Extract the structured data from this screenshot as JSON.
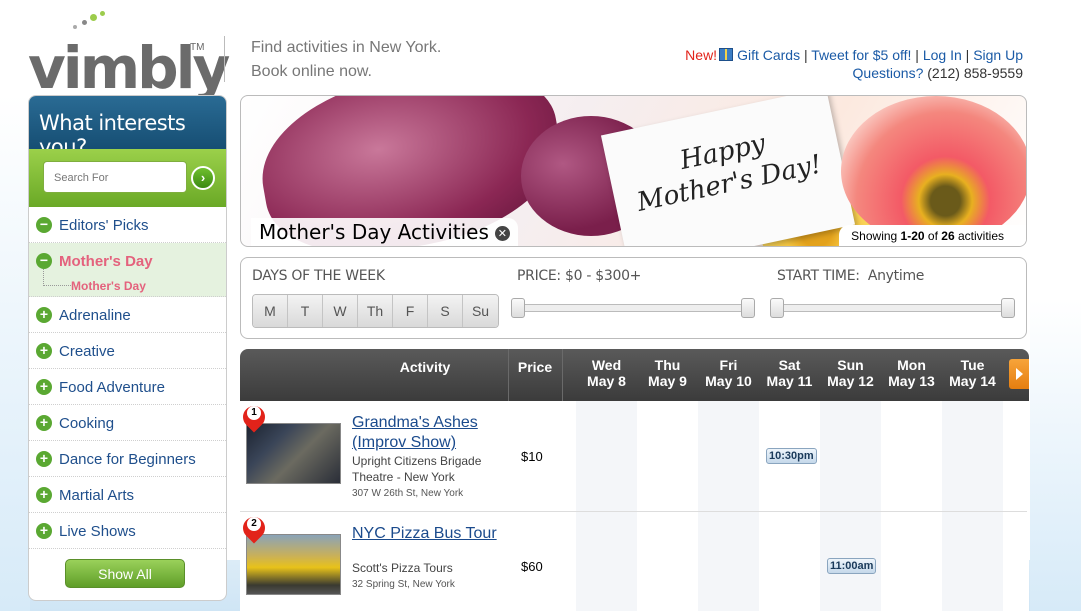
{
  "brand": {
    "name": "vimbly",
    "tm": "TM"
  },
  "tagline": {
    "line1": "Find activities in New York.",
    "line2": "Book online now."
  },
  "toplinks": {
    "new": "New!",
    "gift_cards": "Gift Cards",
    "tweet": "Tweet for $5 off!",
    "login": "Log In",
    "signup": "Sign Up",
    "questions": "Questions?",
    "phone": "(212) 858-9559"
  },
  "sidebar": {
    "header": "What interests you?",
    "search_placeholder": "Search For",
    "items": [
      {
        "label": "Editors' Picks",
        "icon": "minus"
      },
      {
        "label": "Mother's Day",
        "icon": "minus",
        "sub": "Mother's Day"
      },
      {
        "label": "Adrenaline",
        "icon": "plus"
      },
      {
        "label": "Creative",
        "icon": "plus"
      },
      {
        "label": "Food Adventure",
        "icon": "plus"
      },
      {
        "label": "Cooking",
        "icon": "plus"
      },
      {
        "label": "Dance for Beginners",
        "icon": "plus"
      },
      {
        "label": "Martial Arts",
        "icon": "plus"
      },
      {
        "label": "Live Shows",
        "icon": "plus"
      }
    ],
    "show_all": "Show All"
  },
  "banner": {
    "card_line1": "Happy",
    "card_line2": "Mother's Day!",
    "title": "Mother's Day Activities",
    "showing_prefix": "Showing",
    "showing_range": "1-20",
    "showing_of": "of",
    "showing_total": "26",
    "showing_suffix": "activities"
  },
  "filters": {
    "days_label": "DAYS OF THE WEEK",
    "days": [
      "M",
      "T",
      "W",
      "Th",
      "F",
      "S",
      "Su"
    ],
    "price_label": "PRICE: $0 - $300+",
    "start_label": "START TIME:",
    "start_value": "Anytime"
  },
  "table": {
    "headers": {
      "activity": "Activity",
      "price": "Price"
    },
    "days": [
      {
        "day": "Wed",
        "date": "May 8"
      },
      {
        "day": "Thu",
        "date": "May 9"
      },
      {
        "day": "Fri",
        "date": "May 10"
      },
      {
        "day": "Sat",
        "date": "May 11"
      },
      {
        "day": "Sun",
        "date": "May 12"
      },
      {
        "day": "Mon",
        "date": "May 13"
      },
      {
        "day": "Tue",
        "date": "May 14"
      }
    ],
    "rows": [
      {
        "num": "1",
        "title_line1": "Grandma's Ashes",
        "title_line2": "(Improv Show)",
        "venue_line1": "Upright Citizens Brigade",
        "venue_line2": "Theatre - New York",
        "address": "307 W 26th St, New York",
        "price": "$10",
        "time": "10:30pm",
        "time_day": "Sat"
      },
      {
        "num": "2",
        "title_line1": "NYC Pizza Bus Tour",
        "venue_line1": "Scott's Pizza Tours",
        "address": "32 Spring St, New York",
        "price": "$60",
        "time": "11:00am",
        "time_day": "Sun"
      }
    ]
  },
  "colors": {
    "accent_green": "#6aa926",
    "header_blue": "#1f5a82",
    "link_blue": "#1a4a8c",
    "highlight_pink": "#e4627d"
  }
}
